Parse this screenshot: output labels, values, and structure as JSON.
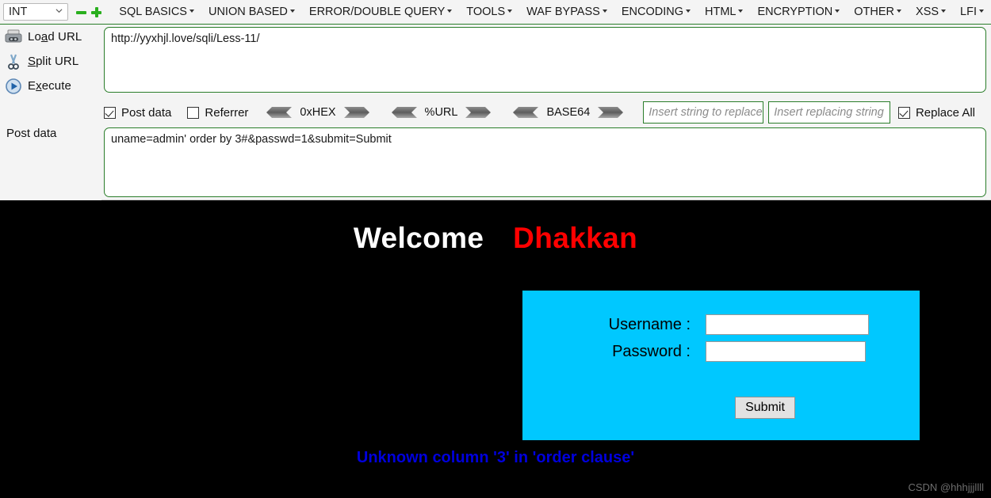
{
  "hackbar": {
    "type_select": {
      "value": "INT",
      "caret_icon": "chevron-down-icon"
    },
    "add_label": "+",
    "remove_label": "-",
    "menu": [
      {
        "label": "SQL BASICS"
      },
      {
        "label": "UNION BASED"
      },
      {
        "label": "ERROR/DOUBLE QUERY"
      },
      {
        "label": "TOOLS"
      },
      {
        "label": "WAF BYPASS"
      },
      {
        "label": "ENCODING"
      },
      {
        "label": "HTML"
      },
      {
        "label": "ENCRYPTION"
      },
      {
        "label": "OTHER"
      },
      {
        "label": "XSS"
      },
      {
        "label": "LFI"
      }
    ],
    "sidebar": [
      {
        "label": "Load URL",
        "accel": "a",
        "icon": "load-url-icon"
      },
      {
        "label": "Split URL",
        "accel": "p",
        "icon": "scissors-icon"
      },
      {
        "label": "Execute",
        "accel": "x",
        "icon": "play-icon"
      }
    ],
    "postdata_section_label": "Post data",
    "url_value": "http://yyxhjl.love/sqli/Less-11/",
    "post_value": "uname=admin' order by 3#&passwd=1&submit=Submit",
    "toolbar": {
      "post_data": {
        "label": "Post data",
        "checked": true
      },
      "referrer": {
        "label": "Referrer",
        "checked": false
      },
      "codecs": [
        {
          "name": "0xHEX"
        },
        {
          "name": "%URL"
        },
        {
          "name": "BASE64"
        }
      ],
      "replace_search_placeholder": "Insert string to replace",
      "replace_with_placeholder": "Insert replacing string",
      "replace_all": {
        "label": "Replace All",
        "checked": true
      }
    },
    "accent_green": "#2a7d2a",
    "plus_green": "#2aaf1e"
  },
  "page": {
    "welcome_text": "Welcome",
    "user_text": "Dhakkan",
    "login": {
      "username_label": "Username :",
      "password_label": "Password :",
      "username_value": "",
      "password_value": "",
      "submit_label": "Submit",
      "panel_color": "#00c8ff"
    },
    "error_message": "Unknown column '3' in 'order clause'",
    "error_color": "#0000dd",
    "watermark": "CSDN @hhhjjjllll"
  }
}
